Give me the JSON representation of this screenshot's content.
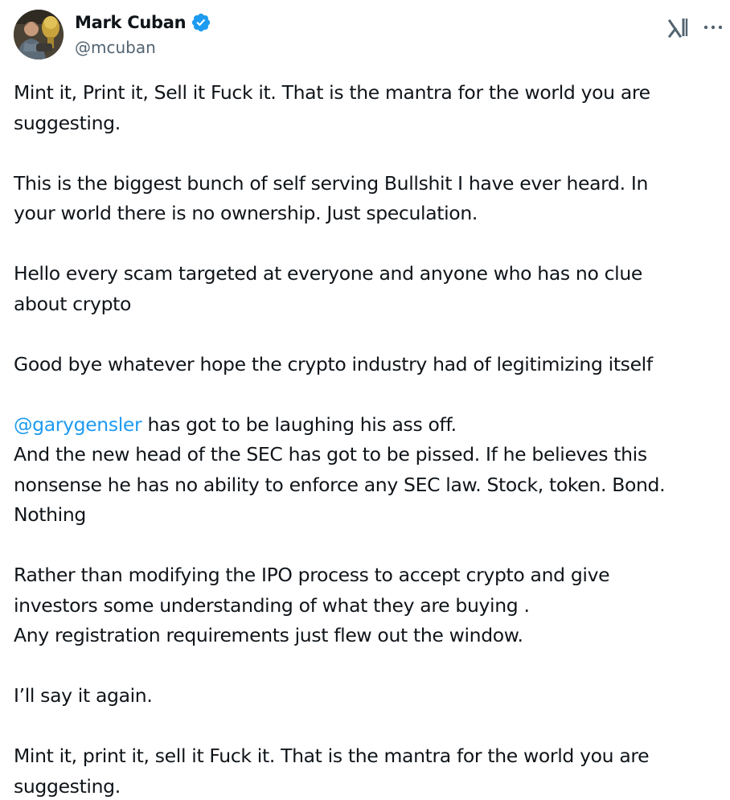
{
  "author": {
    "display_name": "Mark Cuban",
    "handle": "@mcuban",
    "verified": true,
    "avatar_icon": "avatar-photo",
    "verified_color": "#1d9bf0"
  },
  "actions": {
    "grok_icon": "grok-icon",
    "more_icon": "more-options-icon"
  },
  "tweet": {
    "paragraphs": [
      {
        "text": "Mint it, Print it, Sell it  Fuck it.  That is the mantra for the world you are\nsuggesting."
      },
      {
        "text": "This is the biggest bunch of self serving Bullshit I have ever heard.  In\nyour world there is no ownership.  Just speculation."
      },
      {
        "text": "Hello every scam targeted at everyone and anyone who has no clue\nabout crypto"
      },
      {
        "text": "Good bye whatever hope the crypto industry had of legitimizing itself"
      },
      {
        "mention": "@garygensler",
        "text": " has got to be laughing his ass off.\nAnd the new head of the SEC has got to be pissed. If he believes this\nnonsense he has no ability to enforce any SEC law.  Stock, token. Bond.\nNothing"
      },
      {
        "text": "Rather than modifying the IPO process to accept crypto and give\ninvestors some understanding of what they are buying .\nAny registration requirements just flew out the window."
      },
      {
        "text": "I’ll say it again."
      },
      {
        "text": "Mint it, print it, sell it  Fuck it.  That is the mantra for the world you are\nsuggesting."
      }
    ]
  },
  "colors": {
    "text": "#0f1419",
    "secondary": "#536471",
    "link": "#1d9bf0"
  }
}
